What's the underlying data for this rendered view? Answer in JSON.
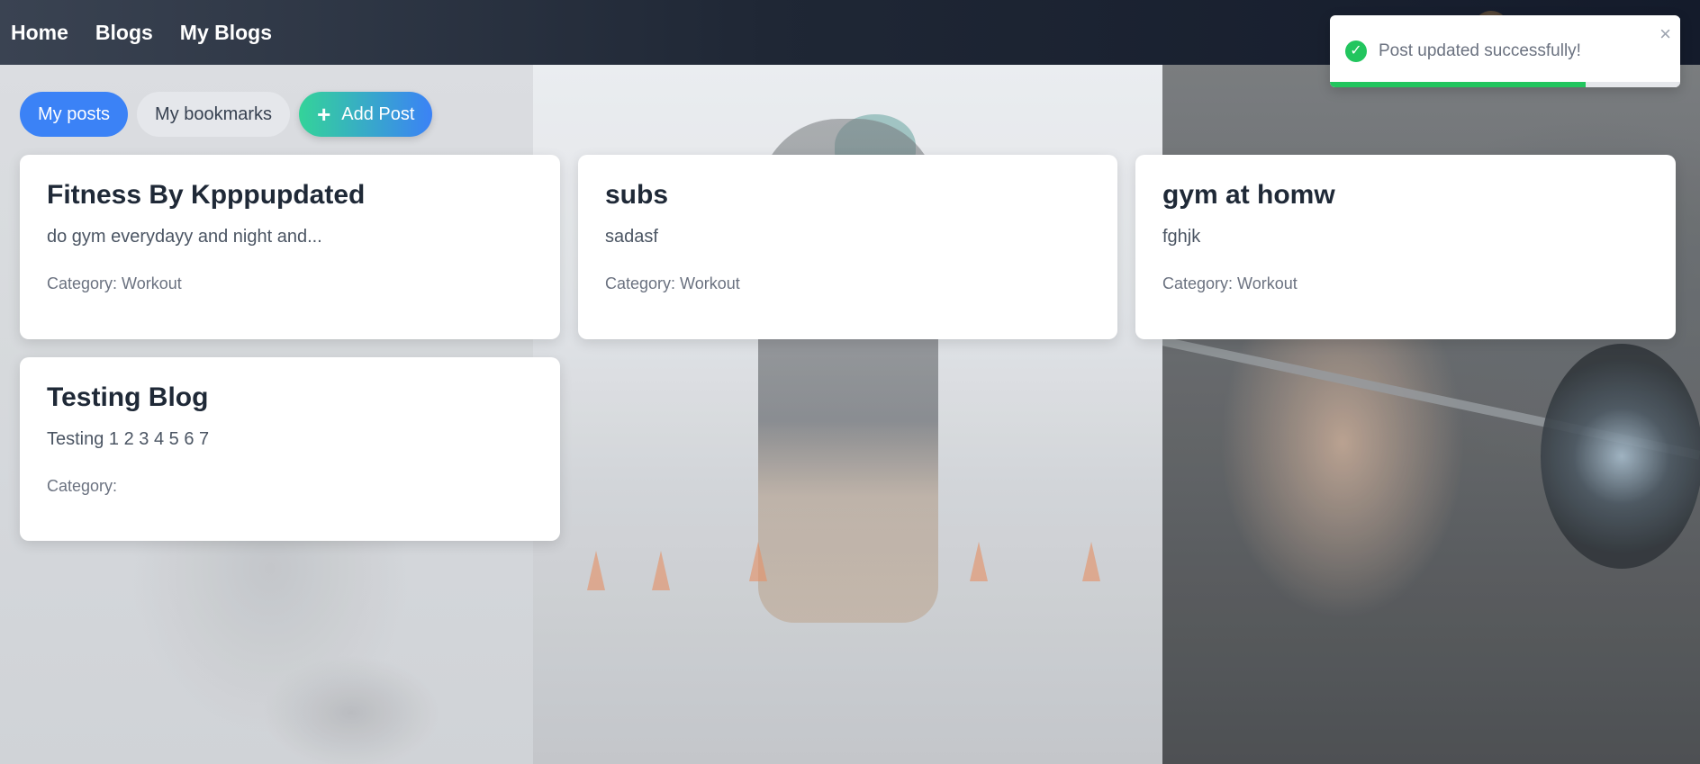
{
  "nav": {
    "links": [
      "Home",
      "Blogs",
      "My Blogs"
    ]
  },
  "actions": {
    "my_posts": "My posts",
    "my_bookmarks": "My bookmarks",
    "add_post": "Add Post",
    "add_icon": "plus-icon"
  },
  "posts": [
    {
      "title": "Fitness By Kpppupdated",
      "excerpt": "do gym everydayy and night and...",
      "category": "Category: Workout"
    },
    {
      "title": "subs",
      "excerpt": "sadasf",
      "category": "Category: Workout"
    },
    {
      "title": "gym at homw",
      "excerpt": "fghjk",
      "category": "Category: Workout"
    },
    {
      "title": "Testing Blog",
      "excerpt": "Testing 1 2 3 4 5 6 7",
      "category": "Category:"
    }
  ],
  "toast": {
    "message": "Post updated successfully!",
    "icon": "check-circle-icon",
    "close_icon": "close-icon",
    "progress": 0.73
  },
  "colors": {
    "primary": "#3b82f6",
    "success": "#22c55e",
    "navbar": "#1f2735"
  }
}
